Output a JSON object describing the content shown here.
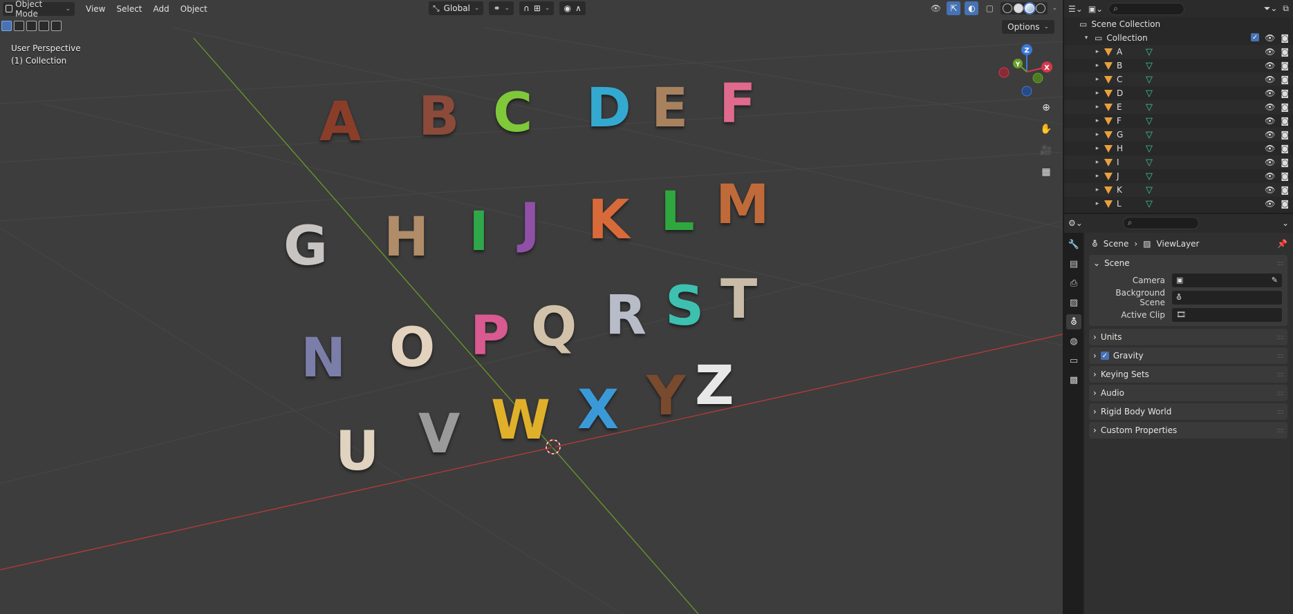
{
  "header": {
    "mode": "Object Mode",
    "menus": [
      "View",
      "Select",
      "Add",
      "Object"
    ],
    "transform_orientation": "Global",
    "options_label": "Options"
  },
  "viewport": {
    "info_line1": "User Perspective",
    "info_line2": "(1) Collection",
    "gizmo_axes": [
      "Z",
      "Y",
      "X"
    ],
    "letters": [
      {
        "ch": "A",
        "color": "#8a3e2a"
      },
      {
        "ch": "B",
        "color": "#8b4a3a"
      },
      {
        "ch": "C",
        "color": "#7ec83a"
      },
      {
        "ch": "D",
        "color": "#34a9d0"
      },
      {
        "ch": "E",
        "color": "#a8825e"
      },
      {
        "ch": "F",
        "color": "#e06a8e"
      },
      {
        "ch": "G",
        "color": "#c8c4c2"
      },
      {
        "ch": "H",
        "color": "#b08c68"
      },
      {
        "ch": "I",
        "color": "#2fa84a"
      },
      {
        "ch": "J",
        "color": "#9050a8"
      },
      {
        "ch": "K",
        "color": "#d86a3a"
      },
      {
        "ch": "L",
        "color": "#2ea83e"
      },
      {
        "ch": "M",
        "color": "#c06a3a"
      },
      {
        "ch": "N",
        "color": "#7a7ea8"
      },
      {
        "ch": "O",
        "color": "#e2d2be"
      },
      {
        "ch": "P",
        "color": "#d85a90"
      },
      {
        "ch": "Q",
        "color": "#d2c2aa"
      },
      {
        "ch": "R",
        "color": "#b8bcc8"
      },
      {
        "ch": "S",
        "color": "#3ec0b0"
      },
      {
        "ch": "T",
        "color": "#c8bca8"
      },
      {
        "ch": "U",
        "color": "#e0d4c0"
      },
      {
        "ch": "V",
        "color": "#9a9a9a"
      },
      {
        "ch": "W",
        "color": "#e0b02a"
      },
      {
        "ch": "X",
        "color": "#3a9ad8"
      },
      {
        "ch": "Y",
        "color": "#7a4a2e"
      },
      {
        "ch": "Z",
        "color": "#e8e8e8"
      }
    ]
  },
  "outliner": {
    "scene_collection": "Scene Collection",
    "collection": "Collection",
    "objects": [
      "A",
      "B",
      "C",
      "D",
      "E",
      "F",
      "G",
      "H",
      "I",
      "J",
      "K",
      "L"
    ]
  },
  "properties": {
    "breadcrumb_scene": "Scene",
    "breadcrumb_layer": "ViewLayer",
    "scene_panel": "Scene",
    "fields": [
      {
        "label": "Camera"
      },
      {
        "label": "Background Scene"
      },
      {
        "label": "Active Clip"
      }
    ],
    "panels": [
      "Units",
      "Gravity",
      "Keying Sets",
      "Audio",
      "Rigid Body World",
      "Custom Properties"
    ]
  }
}
